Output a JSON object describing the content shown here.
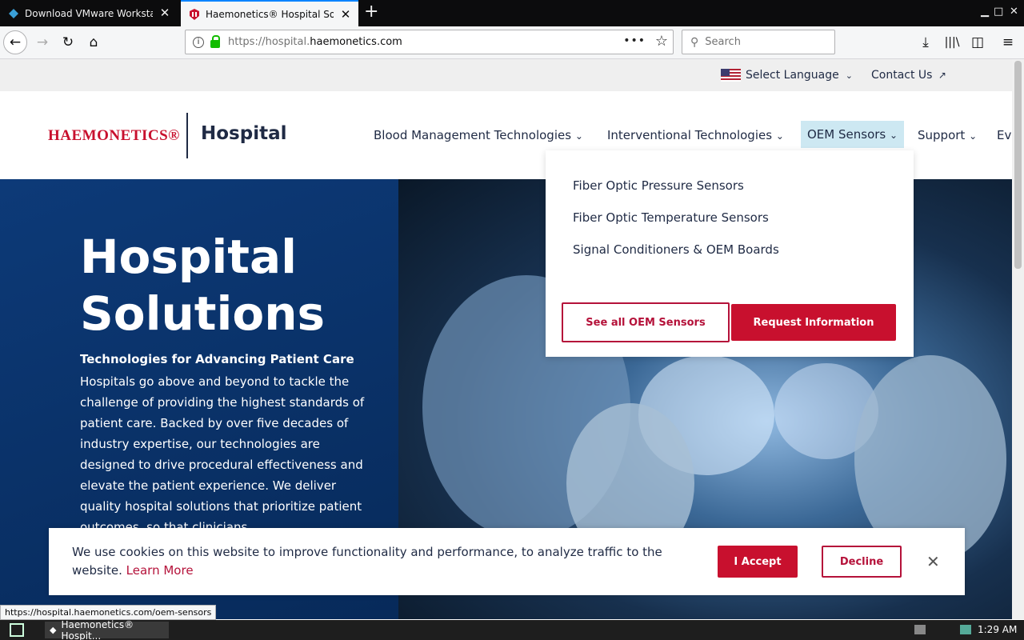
{
  "browser": {
    "tabs": [
      {
        "title": "Download VMware Workstation Pro",
        "active": false
      },
      {
        "title": "Haemonetics® Hospital Solutions",
        "active": true
      }
    ],
    "url_prefix": "https://hospital.",
    "url_domain": "haemonetics.com",
    "search_placeholder": "Search",
    "status_url": "https://hospital.haemonetics.com/oem-sensors"
  },
  "utility": {
    "language_label": "Select Language",
    "contact_label": "Contact Us"
  },
  "header": {
    "logo_text": "HAEMONETICS®",
    "site_name": "Hospital",
    "nav": [
      {
        "label": "Blood Management Technologies"
      },
      {
        "label": "Interventional Technologies"
      },
      {
        "label": "OEM Sensors"
      },
      {
        "label": "Support"
      },
      {
        "label": "Ev"
      }
    ]
  },
  "dropdown": {
    "items": [
      "Fiber Optic Pressure Sensors",
      "Fiber Optic Temperature Sensors",
      "Signal Conditioners & OEM Boards"
    ],
    "see_all_label": "See all OEM Sensors",
    "request_label": "Request Information"
  },
  "hero": {
    "title_line1": "Hospital",
    "title_line2": "Solutions",
    "subtitle": "Technologies for Advancing Patient Care",
    "paragraph": "Hospitals go above and beyond to tackle the challenge of providing the highest standards of patient care. Backed by over five decades of industry expertise, our technologies are designed to drive procedural effectiveness and elevate the patient experience. We deliver quality hospital solutions that prioritize patient outcomes, so that clinicians"
  },
  "cookie": {
    "text": "We use cookies on this website to improve functionality and performance, to analyze traffic to the website.",
    "learn_more": "Learn More",
    "accept_label": "I Accept",
    "decline_label": "Decline"
  },
  "taskbar": {
    "window_label": "Haemonetics® Hospit...",
    "clock": "1:29 AM"
  },
  "colors": {
    "brand_red": "#c8102e",
    "navy": "#1f2a44",
    "nav_highlight": "#cde8f2"
  }
}
